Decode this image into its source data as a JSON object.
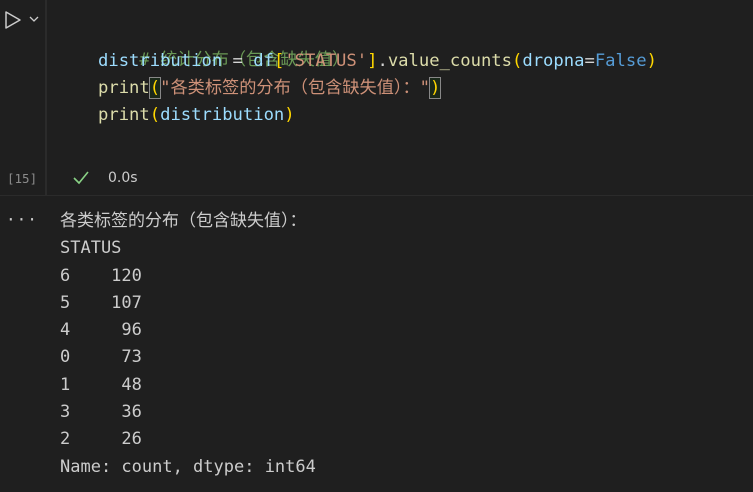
{
  "cell": {
    "execution_count": "[15]",
    "status": "success",
    "exec_time": "0.0s",
    "code": {
      "line1": {
        "comment": "# 统计分布（包含缺失值）"
      },
      "line2": {
        "var": "distribution",
        "eq": " = ",
        "obj": "df",
        "lb": "[",
        "key": "'STATUS'",
        "rb": "]",
        "dot": ".",
        "method": "value_counts",
        "lp": "(",
        "param": "dropna",
        "assign": "=",
        "value": "False",
        "rp": ")"
      },
      "line3": {
        "fn": "print",
        "lp": "(",
        "str": "\"各类标签的分布（包含缺失值）：\"",
        "rp": ")"
      },
      "line4": {
        "fn": "print",
        "lp": "(",
        "arg": "distribution",
        "rp": ")"
      }
    }
  },
  "output": {
    "menu_label": "···",
    "lines": [
      "各类标签的分布（包含缺失值）：",
      "STATUS",
      "6    120",
      "5    107",
      "4     96",
      "0     73",
      "1     48",
      "3     36",
      "2     26",
      "Name: count, dtype: int64"
    ]
  },
  "colors": {
    "background": "#1f1f1f",
    "success": "#89d185",
    "comment": "#6a9955",
    "variable": "#9cdcfe",
    "function": "#dcdcaa",
    "string": "#ce9178",
    "keyword": "#569cd6"
  },
  "icons": {
    "run": "play-triangle-icon",
    "run_menu": "chevron-down-icon",
    "status": "check-icon",
    "output_menu": "ellipsis-icon"
  }
}
